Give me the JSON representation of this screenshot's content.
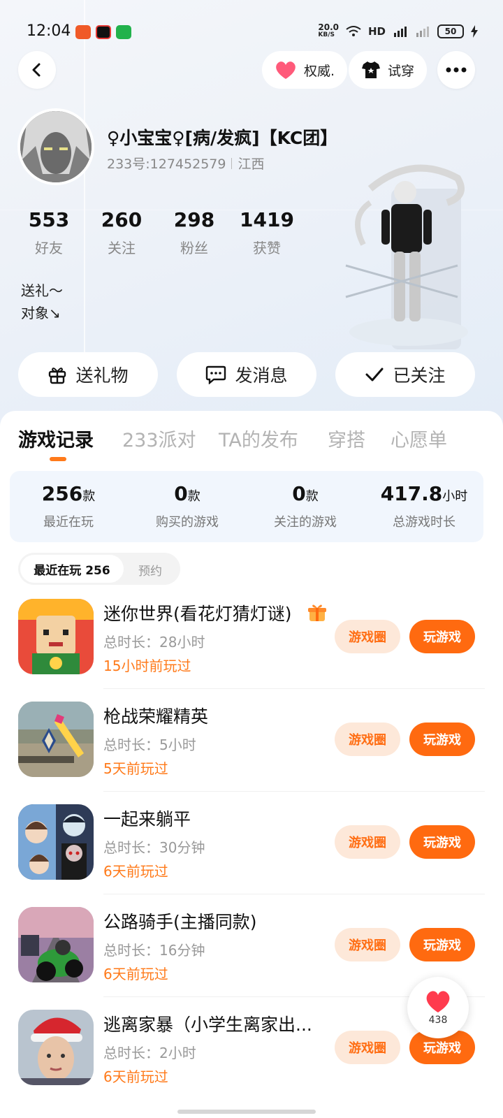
{
  "status_bar": {
    "time": "12:04",
    "net_speed_top": "20.0",
    "net_speed_unit": "KB/S",
    "hd_label": "HD",
    "battery": "50"
  },
  "header": {
    "authority_label": "权威.",
    "try_on_label": "试穿"
  },
  "profile": {
    "name": "♀小宝宝♀[病/发疯]【KC团】",
    "uid": "233号:127452579",
    "region": "江西",
    "stats": [
      {
        "value": "553",
        "label": "好友"
      },
      {
        "value": "260",
        "label": "关注"
      },
      {
        "value": "298",
        "label": "粉丝"
      },
      {
        "value": "1419",
        "label": "获赞"
      }
    ],
    "bio_line1": "送礼～",
    "bio_line2": "对象↘"
  },
  "actions": {
    "gift": "送礼物",
    "message": "发消息",
    "followed": "已关注"
  },
  "tabs": [
    "游戏记录",
    "233派对",
    "TA的发布",
    "穿搭",
    "心愿单"
  ],
  "summary": [
    {
      "value": "256",
      "unit": "款",
      "caption": "最近在玩"
    },
    {
      "value": "0",
      "unit": "款",
      "caption": "购买的游戏"
    },
    {
      "value": "0",
      "unit": "款",
      "caption": "关注的游戏"
    },
    {
      "value": "417.8",
      "unit": "小时",
      "caption": "总游戏时长"
    }
  ],
  "subtabs": {
    "recent": "最近在玩 256",
    "reserve": "预约"
  },
  "games": [
    {
      "title": "迷你世界(看花灯猜灯谜)",
      "duration": "总时长：28小时",
      "played": "15小时前玩过",
      "circle": "游戏圈",
      "play": "玩游戏"
    },
    {
      "title": "枪战荣耀精英",
      "duration": "总时长：5小时",
      "played": "5天前玩过",
      "circle": "游戏圈",
      "play": "玩游戏"
    },
    {
      "title": "一起来躺平",
      "duration": "总时长：30分钟",
      "played": "6天前玩过",
      "circle": "游戏圈",
      "play": "玩游戏"
    },
    {
      "title": "公路骑手(主播同款)",
      "duration": "总时长：16分钟",
      "played": "6天前玩过",
      "circle": "游戏圈",
      "play": "玩游戏"
    },
    {
      "title": "逃离家暴（小学生离家出...",
      "duration": "总时长：2小时",
      "played": "6天前玩过",
      "circle": "游戏圈",
      "play": "玩游戏"
    }
  ],
  "like_fab": {
    "count": "438"
  },
  "colors": {
    "accent": "#ff6a10",
    "accent_light": "#fde8d9",
    "summary_bg": "#f1f6fd"
  }
}
